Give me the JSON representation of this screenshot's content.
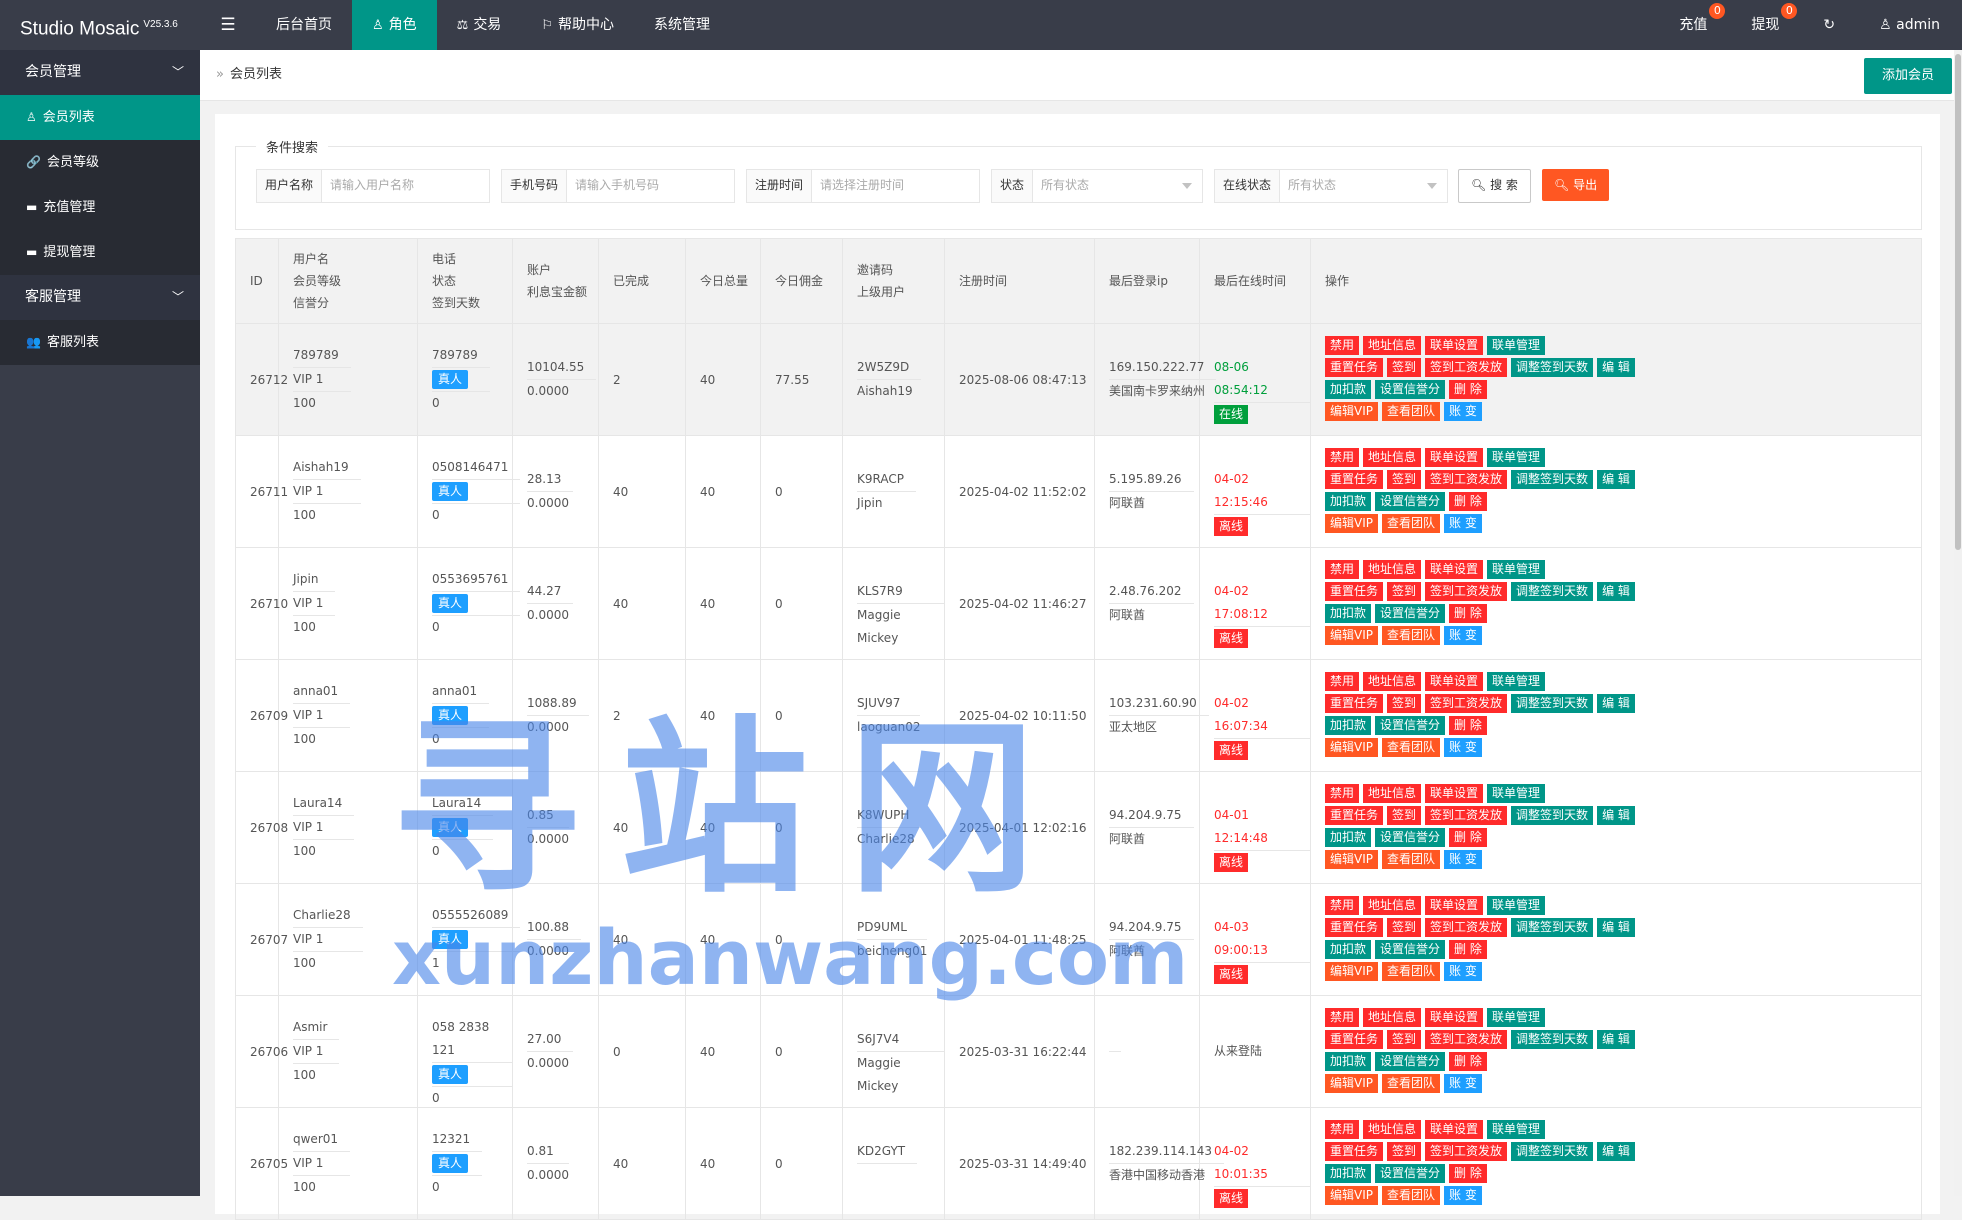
{
  "header": {
    "brand": "Studio Mosaic",
    "version": "V25.3.6",
    "nav": [
      {
        "label": "后台首页",
        "icon": "home-icon"
      },
      {
        "label": "角色",
        "icon": "user-icon"
      },
      {
        "label": "交易",
        "icon": "scale-icon"
      },
      {
        "label": "帮助中心",
        "icon": "flag-icon"
      },
      {
        "label": "系统管理",
        "icon": ""
      }
    ],
    "recharge_label": "充值",
    "recharge_badge": "0",
    "withdraw_label": "提现",
    "withdraw_badge": "0",
    "refresh_icon": "↻",
    "user_label": "admin"
  },
  "sidebar": {
    "group1": "会员管理",
    "items1": [
      "会员列表",
      "会员等级",
      "充值管理",
      "提现管理"
    ],
    "group2": "客服管理",
    "items2": [
      "客服列表"
    ]
  },
  "breadcrumb": "会员列表",
  "add_button": "添加会员",
  "search": {
    "legend": "条件搜索",
    "username_label": "用户名称",
    "username_placeholder": "请输入用户名称",
    "phone_label": "手机号码",
    "phone_placeholder": "请输入手机号码",
    "regtime_label": "注册时间",
    "regtime_placeholder": "请选择注册时间",
    "status_label": "状态",
    "status_value": "所有状态",
    "online_label": "在线状态",
    "online_value": "所有状态",
    "search_button": "搜 索",
    "export_button": "导出"
  },
  "table": {
    "headers": {
      "id": "ID",
      "user": [
        "用户名",
        "会员等级",
        "信誉分"
      ],
      "phone": [
        "电话",
        "状态",
        "签到天数"
      ],
      "account": [
        "账户",
        "利息宝金额"
      ],
      "done": "已完成",
      "today_total": "今日总量",
      "today_comm": "今日佣金",
      "invite": [
        "邀请码",
        "上级用户"
      ],
      "regtime": "注册时间",
      "last_ip": "最后登录ip",
      "last_online": "最后在线时间",
      "ops": "操作"
    },
    "real_label": "真人",
    "op_labels": [
      "禁用",
      "地址信息",
      "联单设置",
      "联单管理",
      "重置任务",
      "签到",
      "签到工资发放",
      "调整签到天数",
      "编 辑",
      "加扣款",
      "设置信誉分",
      "删 除",
      "编辑VIP",
      "查看团队",
      "账 变"
    ],
    "rows": [
      {
        "id": "26712",
        "user": "789789",
        "vip": "VIP 1",
        "credit": "100",
        "phone": "789789",
        "sign": "0",
        "balance": "10104.55",
        "interest": "0.0000",
        "done": "2",
        "total": "40",
        "comm": "77.55",
        "invite": "2W5Z9D",
        "parent": "Aishah19",
        "reg": "2025-08-06 08:47:13",
        "ip": "169.150.222.77",
        "loc": "美国南卡罗来纳州",
        "last": "08-06 08:54:12",
        "online": "在线",
        "online_flag": true
      },
      {
        "id": "26711",
        "user": "Aishah19",
        "vip": "VIP 1",
        "credit": "100",
        "phone": "0508146471",
        "sign": "0",
        "balance": "28.13",
        "interest": "0.0000",
        "done": "40",
        "total": "40",
        "comm": "0",
        "invite": "K9RACP",
        "parent": "Jipin",
        "reg": "2025-04-02 11:52:02",
        "ip": "5.195.89.26",
        "loc": "阿联酋",
        "last": "04-02 12:15:46",
        "online": "离线",
        "online_flag": false
      },
      {
        "id": "26710",
        "user": "Jipin",
        "vip": "VIP 1",
        "credit": "100",
        "phone": "0553695761",
        "sign": "0",
        "balance": "44.27",
        "interest": "0.0000",
        "done": "40",
        "total": "40",
        "comm": "0",
        "invite": "KLS7R9",
        "parent": "Maggie Mickey",
        "reg": "2025-04-02 11:46:27",
        "ip": "2.48.76.202",
        "loc": "阿联酋",
        "last": "04-02 17:08:12",
        "online": "离线",
        "online_flag": false
      },
      {
        "id": "26709",
        "user": "anna01",
        "vip": "VIP 1",
        "credit": "100",
        "phone": "anna01",
        "sign": "0",
        "balance": "1088.89",
        "interest": "0.0000",
        "done": "2",
        "total": "40",
        "comm": "0",
        "invite": "SJUV97",
        "parent": "laoguan02",
        "reg": "2025-04-02 10:11:50",
        "ip": "103.231.60.90",
        "loc": "亚太地区",
        "last": "04-02 16:07:34",
        "online": "离线",
        "online_flag": false
      },
      {
        "id": "26708",
        "user": "Laura14",
        "vip": "VIP 1",
        "credit": "100",
        "phone": "Laura14",
        "sign": "0",
        "balance": "0.85",
        "interest": "0.0000",
        "done": "40",
        "total": "40",
        "comm": "0",
        "invite": "K8WUPH",
        "parent": "Charlie28",
        "reg": "2025-04-01 12:02:16",
        "ip": "94.204.9.75",
        "loc": "阿联酋",
        "last": "04-01 12:14:48",
        "online": "离线",
        "online_flag": false
      },
      {
        "id": "26707",
        "user": "Charlie28",
        "vip": "VIP 1",
        "credit": "100",
        "phone": "0555526089",
        "sign": "1",
        "balance": "100.88",
        "interest": "0.0000",
        "done": "40",
        "total": "40",
        "comm": "0",
        "invite": "PD9UML",
        "parent": "beicheng01",
        "reg": "2025-04-01 11:48:25",
        "ip": "94.204.9.75",
        "loc": "阿联酋",
        "last": "04-03 09:00:13",
        "online": "离线",
        "online_flag": false
      },
      {
        "id": "26706",
        "user": "Asmir",
        "vip": "VIP 1",
        "credit": "100",
        "phone": "058 2838 121",
        "sign": "0",
        "balance": "27.00",
        "interest": "0.0000",
        "done": "0",
        "total": "40",
        "comm": "0",
        "invite": "S6J7V4",
        "parent": "Maggie Mickey",
        "reg": "2025-03-31 16:22:44",
        "ip": "",
        "loc": "",
        "last": "从来登陆",
        "online": "",
        "online_flag": null
      },
      {
        "id": "26705",
        "user": "qwer01",
        "vip": "VIP 1",
        "credit": "100",
        "phone": "12321",
        "sign": "0",
        "balance": "0.81",
        "interest": "0.0000",
        "done": "40",
        "total": "40",
        "comm": "0",
        "invite": "KD2GYT",
        "parent": "",
        "reg": "2025-03-31 14:49:40",
        "ip": "182.239.114.143",
        "loc": "香港中国移动香港",
        "last": "04-02 10:01:35",
        "online": "离线",
        "online_flag": false
      }
    ]
  },
  "watermark": {
    "cn": "寻站网",
    "en": "xunzhanwang.com"
  },
  "colors": {
    "accent": "#009688",
    "danger": "#ff2b2b",
    "warning": "#ff5722",
    "info": "#1e9fff",
    "online": "#009f3c",
    "dark": "#393d49"
  }
}
